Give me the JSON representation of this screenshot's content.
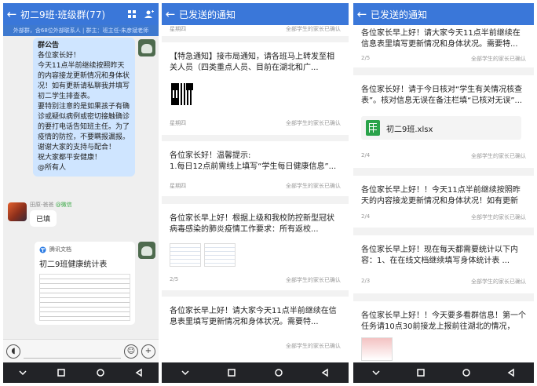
{
  "panel1": {
    "title": "初二9班·班级群(77)",
    "subtitle": "外部群，含68位外部联系人 | 群主：班主任-朱彦斌老师",
    "announcement": {
      "head": "群公告",
      "lines": [
        "各位家长好！",
        "今天11点半前继续按照昨天的内容接龙更新情况和身体状况！如有更新请私聊我并填写初二学生排查表。",
        "要特别注意的是如果孩子有确诊或疑似病例或密切接触确诊的要打电话告知班主任。为了疫情的防控，不要瞒报漏报。谢谢大家的支持与配合！",
        "祝大家都平安健康！",
        "@所有人"
      ]
    },
    "sender_name": "田原-爸爸",
    "sender_badge": "@微信",
    "reply": "已填",
    "doc_source": "腾讯文档",
    "doc_title": "初二9班健康统计表"
  },
  "panel2": {
    "title": "已发送的通知",
    "top_meta": {
      "left": "星期四",
      "right": "全部学生的家长已确认"
    },
    "cards": [
      {
        "text": "【特急通知】接市局通知，请各班马上转发至相关人员（四类重点人员、目前在湖北和广...",
        "left": "星期四",
        "right": "全部学生的家长已确认"
      },
      {
        "text": "各位家长好！温馨提示:\n1.每日12点前需线上填写“学生每日健康信息”...",
        "left": "星期四",
        "right": "全部学生的家长已确认"
      },
      {
        "text": "各位家长早上好！根据上级和我校防控新型冠状病毒感染的肺炎疫情工作要求：所有返校...",
        "left": "2/5",
        "right": "全部学生的家长已确认"
      },
      {
        "text": "各位家长早上好！请大家今天11点半前继续在信息表里填写更新情况和身体状况。需要特...",
        "left": "",
        "right": "全部学生的家长已确认"
      }
    ]
  },
  "panel3": {
    "title": "已发送的通知",
    "cards": [
      {
        "text": "各位家长早上好！请大家今天11点半前继续在信息表里填写更新情况和身体状况。需要特...",
        "left": "2/5",
        "right": "全部学生的家长已确认"
      },
      {
        "text": "各位家长好！请于今日核对“学生有关情况核查表”。核对信息无误在备注栏填“已核对无误”...",
        "file": "初二9班.xlsx",
        "left": "2/4",
        "right": "全部学生的家长已确认"
      },
      {
        "text": "各位家长早上好！！今天11点半前继续按照昨天的内容接龙更新情况和身体状况！如有更新请...",
        "left": "2/4",
        "right": "全部学生的家长已确认"
      },
      {
        "text": "各位家长早上好！现在每天都需要统计以下内容：1、在在线文档继续填写身体统计表 ...",
        "left": "2/3",
        "right": "全部学生的家长已确认"
      },
      {
        "text": "各位家长早上好！！今天要多看群信息！第一个任务请10点30前接龙上报前往湖北的情况，写...",
        "left": "",
        "right": ""
      }
    ]
  },
  "colors": {
    "topbar": "#3a77d9",
    "navbar": "#222327",
    "bubble": "#cfe5ff"
  }
}
